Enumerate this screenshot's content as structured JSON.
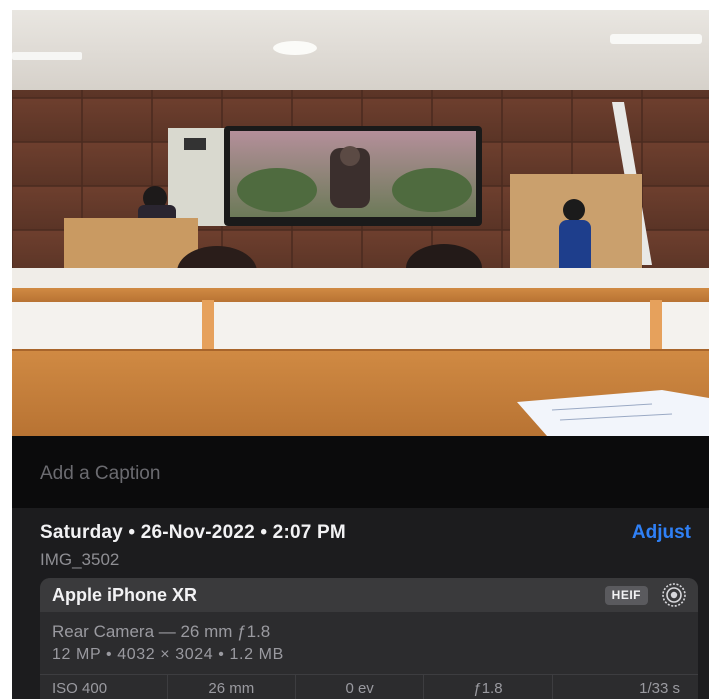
{
  "caption": {
    "placeholder": "Add a Caption"
  },
  "header": {
    "date_time": "Saturday • 26-Nov-2022 • 2:07 PM",
    "adjust_label": "Adjust",
    "filename": "IMG_3502"
  },
  "camera": {
    "device": "Apple iPhone XR",
    "format_badge": "HEIF",
    "lens": "Rear Camera — 26 mm ƒ1.8",
    "specs": "12 MP • 4032 × 3024 • 1.2 MB",
    "exif": [
      "ISO 400",
      "26 mm",
      "0 ev",
      "ƒ1.8",
      "1/33 s"
    ]
  },
  "icons": {
    "live": "live-photo-icon"
  },
  "colors": {
    "accent": "#2f80f6",
    "panel": "#1c1c1e",
    "card": "#2c2c2e"
  }
}
